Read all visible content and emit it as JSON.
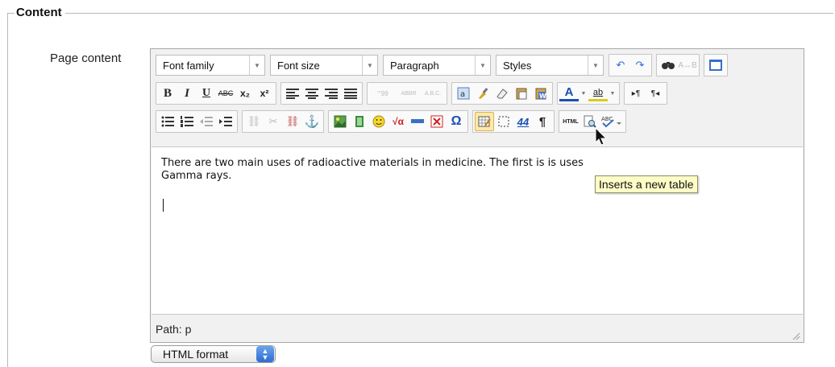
{
  "section": {
    "legend": "Content"
  },
  "field": {
    "label": "Page content"
  },
  "toolbar": {
    "dropdowns": {
      "font_family": "Font family",
      "font_size": "Font size",
      "format": "Paragraph",
      "styles": "Styles"
    },
    "icons": {
      "bold": "B",
      "italic": "I",
      "underline": "U",
      "strikethrough": "ABC",
      "subscript": "x₂",
      "superscript": "x²",
      "cite": "“‘99",
      "abbr": "ABBR",
      "acronym": "A.B.C.",
      "font_color": "A",
      "hilite": "ab",
      "ltr": "▸¶",
      "rtl": "¶◂",
      "anchor": "⚓",
      "omega": "Ω",
      "pilcrow": "¶",
      "html": "HTML",
      "sqrt": "√α",
      "abbr_style": "44"
    }
  },
  "editor": {
    "text_line1": "There are two main uses of radioactive materials in medicine. The first is",
    "text_line1_end": "is uses",
    "text_line2": "Gamma rays."
  },
  "statusbar": {
    "path": "Path: p"
  },
  "format_select": {
    "value": "HTML format"
  },
  "tooltip": {
    "text": "Inserts a new table"
  },
  "colors": {
    "tooltip_bg": "#fefdc7",
    "accent_blue": "#2f6bd3",
    "hover_hl": "#fde9a9"
  }
}
